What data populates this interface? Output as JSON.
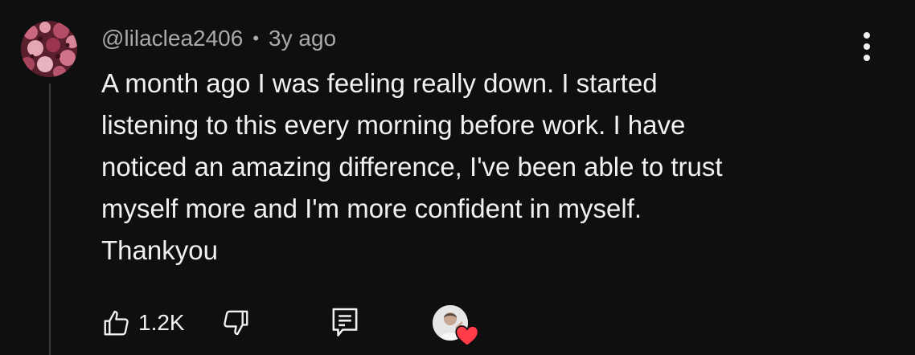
{
  "comment": {
    "author": "@lilaclea2406",
    "separator": "•",
    "time_ago": "3y ago",
    "text_lines": [
      "A month ago I was feeling really down. I started",
      "listening to this every morning before work. I have",
      "noticed an amazing difference, I've been able to trust",
      "myself more and I'm more confident in myself.",
      "Thankyou"
    ],
    "like_count": "1.2K"
  },
  "icons": {
    "like": "thumbs-up-icon",
    "dislike": "thumbs-down-icon",
    "reply": "reply-comment-icon",
    "menu": "more-vertical-icon",
    "creator_heart": "creator-heart-icon"
  },
  "colors": {
    "background": "#0f0f0f",
    "text": "#f1f1f1",
    "meta": "#aaaaaa",
    "heart": "#ff3b4a"
  }
}
